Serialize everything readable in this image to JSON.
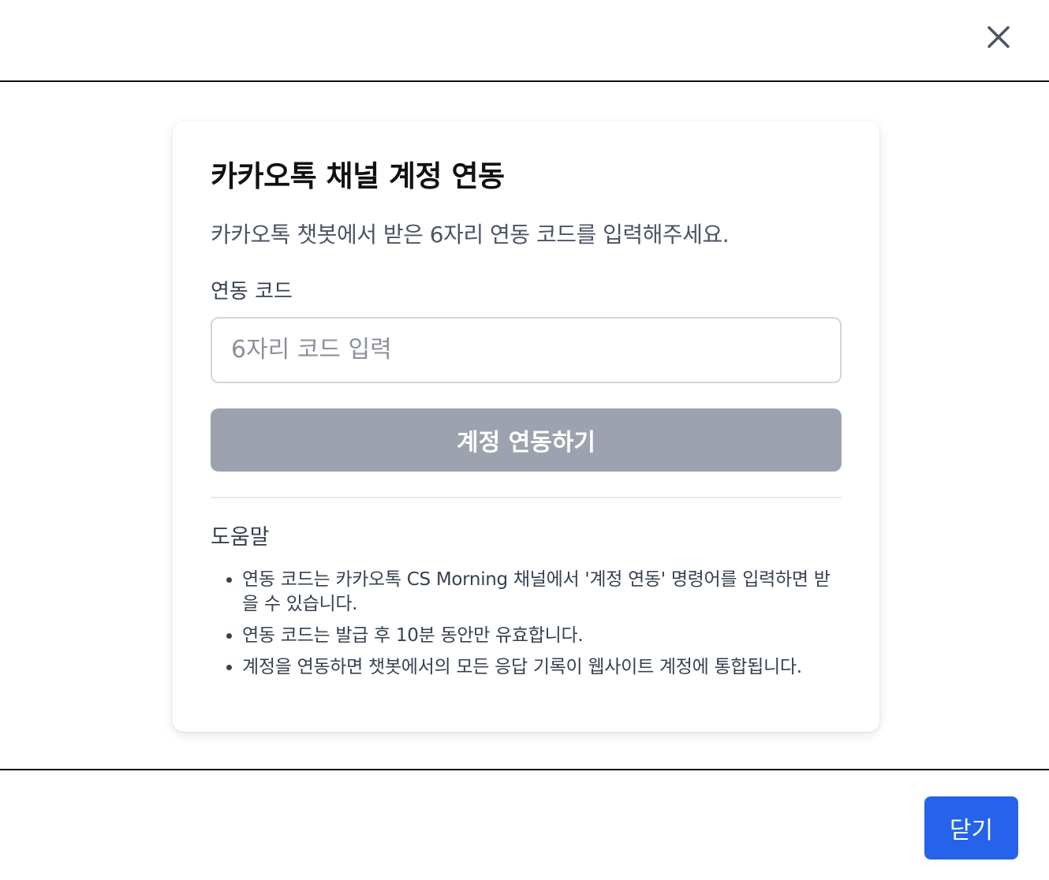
{
  "header": {
    "close_icon": "close-icon"
  },
  "card": {
    "title": "카카오톡 채널 계정 연동",
    "description": "카카오톡 챗봇에서 받은 6자리 연동 코드를 입력해주세요.",
    "code_label": "연동 코드",
    "code_value": "",
    "code_placeholder": "6자리 코드 입력",
    "link_button": "계정 연동하기",
    "help_title": "도움말",
    "help_items": [
      "연동 코드는 카카오톡 CS Morning 채널에서 '계정 연동' 명령어를 입력하면 받을 수 있습니다.",
      "연동 코드는 발급 후 10분 동안만 유효합니다.",
      "계정을 연동하면 챗봇에서의 모든 응답 기록이 웹사이트 계정에 통합됩니다."
    ]
  },
  "footer": {
    "close_button": "닫기"
  },
  "colors": {
    "primary": "#2563eb",
    "disabled_button": "#9ca3af",
    "divider": "#e5e7eb",
    "border": "#d1d5db"
  }
}
